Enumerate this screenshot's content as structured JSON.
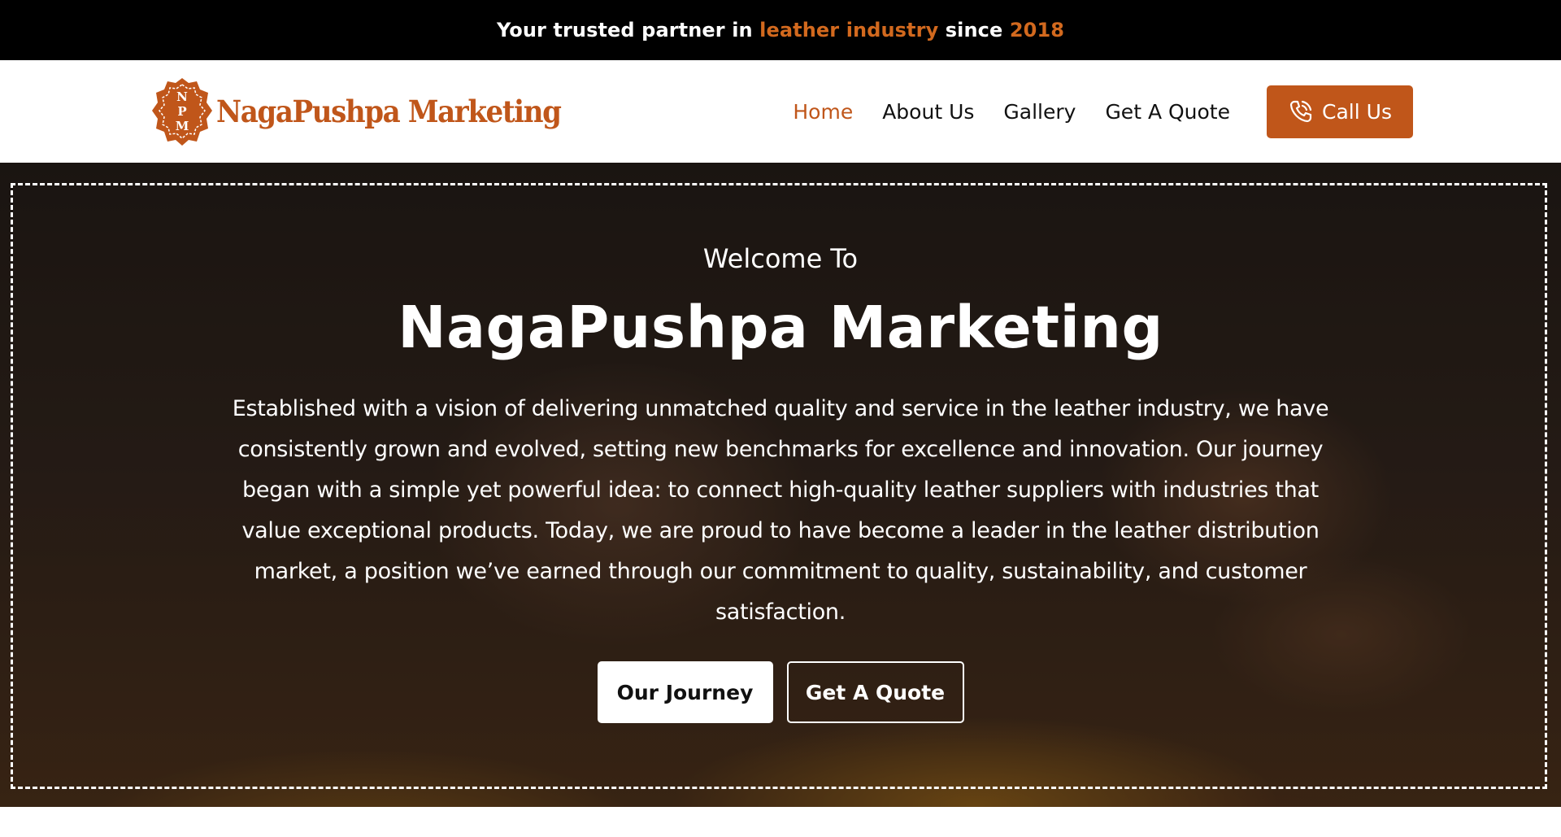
{
  "topbar": {
    "text_before": "Your trusted partner in ",
    "accent_1": "leather industry",
    "text_middle": " since ",
    "accent_2": "2018"
  },
  "header": {
    "logo_text": "NagaPushpa Marketing",
    "logo_initials": [
      "N",
      "P",
      "M"
    ],
    "nav": [
      {
        "label": "Home",
        "active": true
      },
      {
        "label": "About Us",
        "active": false
      },
      {
        "label": "Gallery",
        "active": false
      },
      {
        "label": "Get A Quote",
        "active": false
      }
    ],
    "call_button": {
      "label": "Call Us",
      "icon": "phone-icon"
    }
  },
  "hero": {
    "welcome": "Welcome To",
    "title": "NagaPushpa Marketing",
    "description": "Established with a vision of delivering unmatched quality and service in the leather industry, we have consistently grown and evolved, setting new benchmarks for excellence and innovation. Our journey began with a simple yet powerful idea: to connect high-quality leather suppliers with industries that value exceptional products. Today, we are proud to have become a leader in the leather distribution market, a position we’ve earned through our commitment to quality, sustainability, and customer satisfaction.",
    "buttons": {
      "primary": "Our Journey",
      "secondary": "Get A Quote"
    }
  },
  "colors": {
    "accent": "#c0561a",
    "topbar_accent": "#d2691e",
    "topbar_bg": "#000000"
  }
}
